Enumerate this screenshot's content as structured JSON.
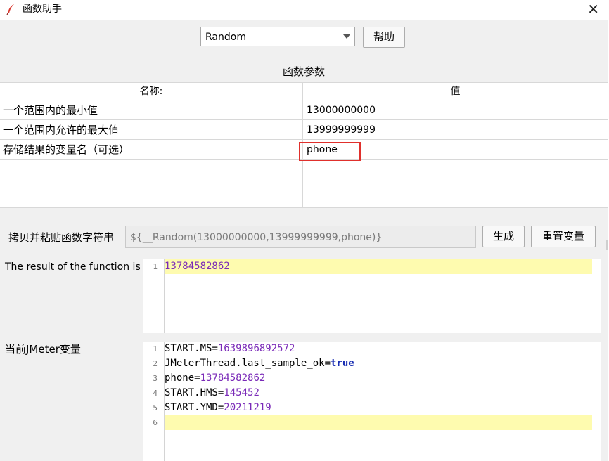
{
  "window": {
    "title": "函数助手",
    "close_glyph": "✕",
    "icon": "feather-icon"
  },
  "function_select": {
    "value": "Random"
  },
  "help_button": {
    "label": "帮助"
  },
  "params": {
    "section_title": "函数参数",
    "columns": [
      "名称:",
      "值"
    ],
    "rows": [
      {
        "name": "一个范围内的最小值",
        "value": "13000000000"
      },
      {
        "name": "一个范围内允许的最大值",
        "value": "13999999999"
      },
      {
        "name": "存储结果的变量名（可选）",
        "value": "phone"
      }
    ]
  },
  "copy": {
    "label": "拷贝并粘贴函数字符串",
    "value": "${__Random(13000000000,13999999999,phone)}",
    "generate_label": "生成",
    "reset_label": "重置变量"
  },
  "result": {
    "label": "The result of the function is",
    "lines": [
      {
        "num": "1",
        "value": "13784582862"
      }
    ]
  },
  "vars": {
    "label": "当前JMeter变量",
    "lines": [
      {
        "num": "1",
        "key": "START.MS",
        "eq": "=",
        "value": "1639896892572"
      },
      {
        "num": "2",
        "key": "JMeterThread.last_sample_ok",
        "eq": "=",
        "value": "true"
      },
      {
        "num": "3",
        "key": "phone",
        "eq": "=",
        "value": "13784582862"
      },
      {
        "num": "4",
        "key": "START.HMS",
        "eq": "=",
        "value": "145452"
      },
      {
        "num": "5",
        "key": "START.YMD",
        "eq": "=",
        "value": "20211219"
      },
      {
        "num": "6",
        "key": "",
        "eq": "",
        "value": ""
      }
    ]
  },
  "colors": {
    "highlight": "#fefbaf",
    "number": "#7a2ab8",
    "keyword": "#1a2fb3",
    "annotation": "#e0302c"
  }
}
